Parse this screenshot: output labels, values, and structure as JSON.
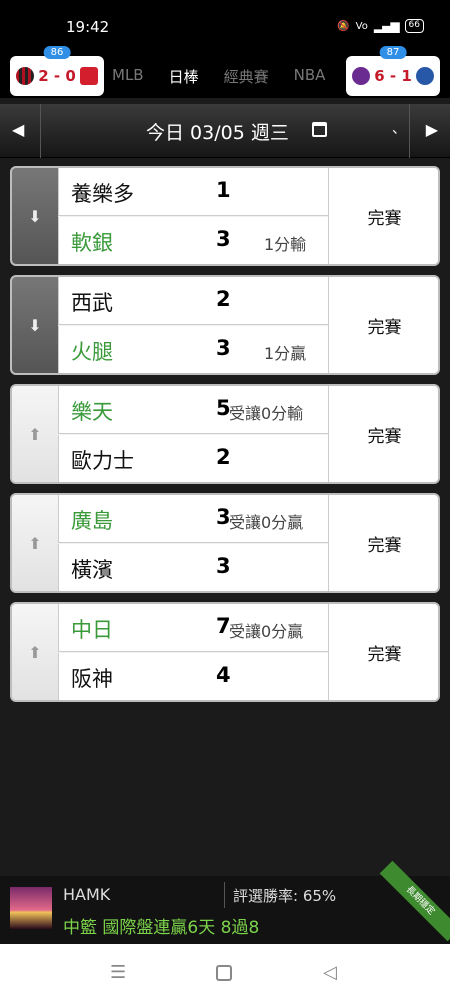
{
  "status_bar": {
    "time": "19:42",
    "icons": [
      "mute-icon",
      "volte-icon",
      "4g-signal-icon",
      "battery-icon"
    ],
    "battery": "66"
  },
  "league_bar": {
    "left_chip": {
      "badge": "86",
      "score": "2 - 0"
    },
    "right_chip": {
      "badge": "87",
      "score": "6 - 1"
    },
    "tabs": [
      "MLB",
      "日棒",
      "經典賽",
      "NBA"
    ],
    "active_tab": "日棒"
  },
  "date_bar": {
    "label": "今日 03/05 週三",
    "tick": "、"
  },
  "games": [
    {
      "arrow": "down",
      "home": {
        "team": "養樂多",
        "score": "1",
        "color": "black",
        "note": ""
      },
      "away": {
        "team": "軟銀",
        "score": "3",
        "color": "green",
        "note": "1分輸"
      },
      "status": "完賽"
    },
    {
      "arrow": "down",
      "home": {
        "team": "西武",
        "score": "2",
        "color": "black",
        "note": ""
      },
      "away": {
        "team": "火腿",
        "score": "3",
        "color": "green",
        "note": "1分贏"
      },
      "status": "完賽"
    },
    {
      "arrow": "up",
      "home": {
        "team": "樂天",
        "score": "5",
        "color": "green",
        "note": "受讓0分輸"
      },
      "away": {
        "team": "歐力士",
        "score": "2",
        "color": "black",
        "note": ""
      },
      "status": "完賽"
    },
    {
      "arrow": "up",
      "home": {
        "team": "廣島",
        "score": "3",
        "color": "green",
        "note": "受讓0分贏"
      },
      "away": {
        "team": "橫濱",
        "score": "3",
        "color": "black",
        "note": ""
      },
      "status": "完賽"
    },
    {
      "arrow": "up",
      "home": {
        "team": "中日",
        "score": "7",
        "color": "green",
        "note": "受讓0分贏"
      },
      "away": {
        "team": "阪神",
        "score": "4",
        "color": "black",
        "note": ""
      },
      "status": "完賽"
    }
  ],
  "ad": {
    "name": "HAMK",
    "rate": "評選勝率: 65%",
    "promo": "中籃 國際盤連贏6天 8過8",
    "ribbon": "長期穩定"
  },
  "nav": {
    "icons": [
      "menu-icon",
      "home-icon",
      "back-icon"
    ]
  }
}
